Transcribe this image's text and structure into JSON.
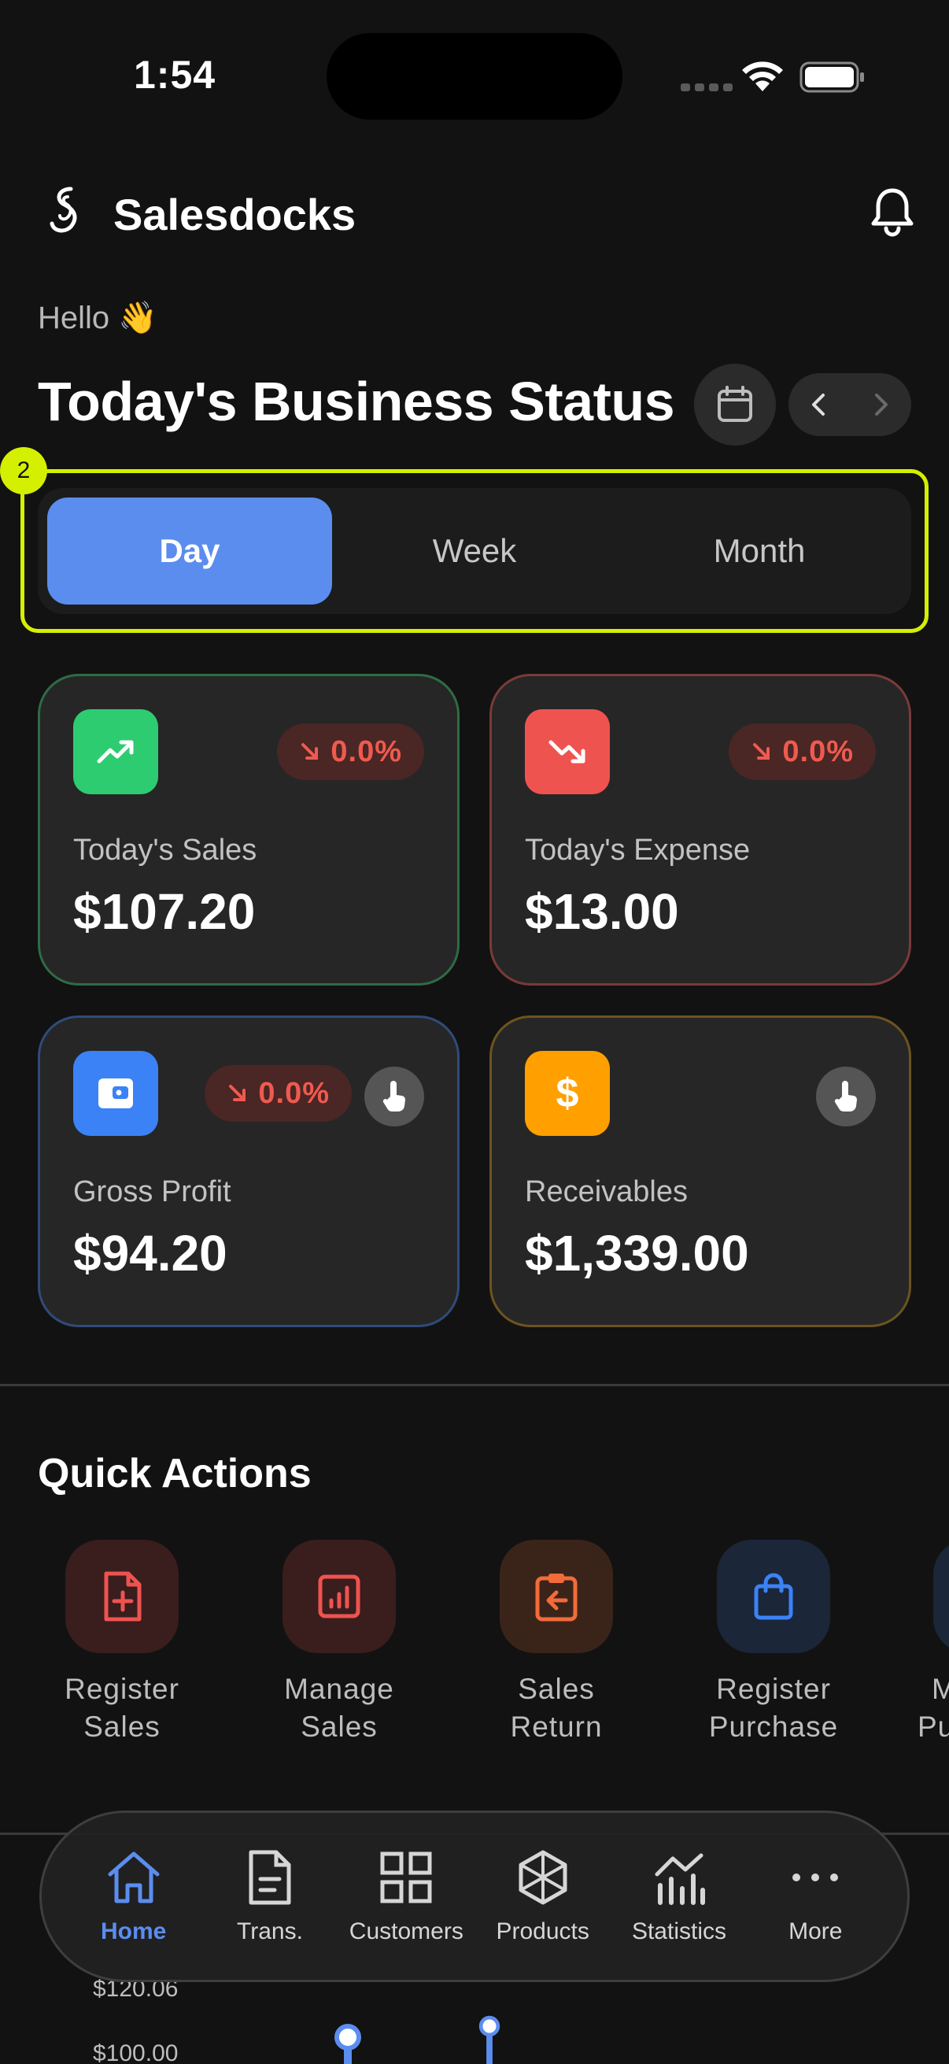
{
  "status": {
    "time": "1:54"
  },
  "header": {
    "app_name": "Salesdocks"
  },
  "greeting": "Hello 👋",
  "page_title": "Today's Business Status",
  "period_tabs": [
    {
      "label": "Day",
      "active": true
    },
    {
      "label": "Week",
      "active": false
    },
    {
      "label": "Month",
      "active": false
    }
  ],
  "highlight_badge": "2",
  "cards": {
    "sales": {
      "label": "Today's Sales",
      "value": "$107.20",
      "change": "0.0%",
      "color": "#2ecc71"
    },
    "expense": {
      "label": "Today's Expense",
      "value": "$13.00",
      "change": "0.0%",
      "color": "#ef5350"
    },
    "profit": {
      "label": "Gross Profit",
      "value": "$94.20",
      "change": "0.0%",
      "color": "#3b82f6"
    },
    "receivables": {
      "label": "Receivables",
      "value": "$1,339.00",
      "color": "#ffa000"
    }
  },
  "quick_actions": {
    "title": "Quick Actions",
    "items": [
      {
        "line1": "Register",
        "line2": "Sales",
        "icon": "file-plus-icon"
      },
      {
        "line1": "Manage",
        "line2": "Sales",
        "icon": "report-chart-icon"
      },
      {
        "line1": "Sales",
        "line2": "Return",
        "icon": "clipboard-return-icon"
      },
      {
        "line1": "Register",
        "line2": "Purchase",
        "icon": "shopping-bag-icon"
      },
      {
        "line1": "M",
        "line2": "Pu",
        "icon": "partial-icon"
      }
    ]
  },
  "chart_peek": {
    "ticks": [
      "$120.06",
      "$100.00"
    ]
  },
  "bottom_nav": [
    {
      "label": "Home",
      "icon": "home-icon",
      "active": true
    },
    {
      "label": "Trans.",
      "icon": "document-icon",
      "active": false
    },
    {
      "label": "Customers",
      "icon": "grid-icon",
      "active": false
    },
    {
      "label": "Products",
      "icon": "cube-icon",
      "active": false
    },
    {
      "label": "Statistics",
      "icon": "bar-chart-icon",
      "active": false
    },
    {
      "label": "More",
      "icon": "more-icon",
      "active": false
    }
  ]
}
